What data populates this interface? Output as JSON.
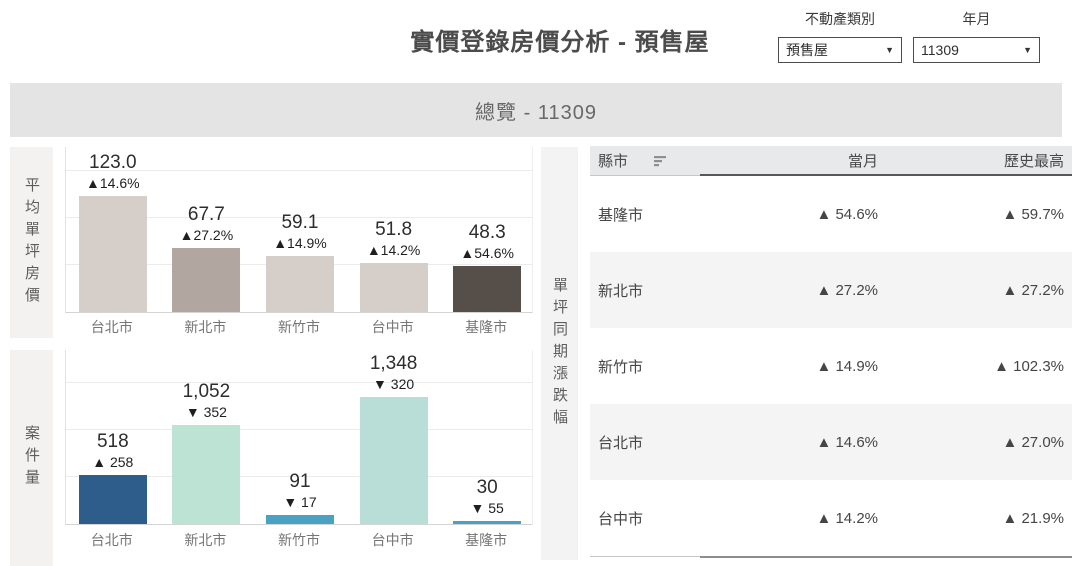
{
  "header": {
    "title": "實價登錄房價分析 - 預售屋",
    "filters": {
      "property_type": {
        "label": "不動產類別",
        "value": "預售屋"
      },
      "year_month": {
        "label": "年月",
        "value": "11309"
      }
    },
    "dropdown_arrow": "▼"
  },
  "banner": {
    "title": "總覽 - 11309"
  },
  "middle_axis_label": "單坪同期漲跌幅",
  "chart_data": [
    {
      "type": "bar",
      "title": "平均單坪房價",
      "categories": [
        "台北市",
        "新北市",
        "新竹市",
        "台中市",
        "基隆市"
      ],
      "values": [
        123.0,
        67.7,
        59.1,
        51.8,
        48.3
      ],
      "value_labels": [
        "123.0",
        "67.7",
        "59.1",
        "51.8",
        "48.3"
      ],
      "change_labels": [
        "▲14.6%",
        "▲27.2%",
        "▲14.9%",
        "▲14.2%",
        "▲54.6%"
      ],
      "bar_colors": [
        "#d5cec9",
        "#b1a7a0",
        "#d5cec9",
        "#d5cec9",
        "#564e49"
      ],
      "xlabel": "",
      "ylabel": "平均單坪房價",
      "ylim": [
        0,
        175
      ],
      "grid": true,
      "legend": false
    },
    {
      "type": "bar",
      "title": "案件量",
      "categories": [
        "台北市",
        "新北市",
        "新竹市",
        "台中市",
        "基隆市"
      ],
      "values": [
        518,
        1052,
        91,
        1348,
        30
      ],
      "value_labels": [
        "518",
        "1,052",
        "91",
        "1,348",
        "30"
      ],
      "change_labels": [
        "▲ 258",
        "▼ 352",
        "▼ 17",
        "▼ 320",
        "▼ 55"
      ],
      "bar_colors": [
        "#2e5d8b",
        "#bce3d3",
        "#4ba1c2",
        "#b9ddd7",
        "#4ba1c2"
      ],
      "xlabel": "",
      "ylabel": "案件量",
      "ylim": [
        0,
        1850
      ],
      "grid": true,
      "legend": false
    },
    {
      "type": "table",
      "title": "單坪同期漲跌幅",
      "columns": [
        "縣市",
        "當月",
        "歷史最高"
      ],
      "rows": [
        [
          "基隆市",
          "▲ 54.6%",
          "▲ 59.7%"
        ],
        [
          "新北市",
          "▲ 27.2%",
          "▲ 27.2%"
        ],
        [
          "新竹市",
          "▲ 14.9%",
          "▲ 102.3%"
        ],
        [
          "台北市",
          "▲ 14.6%",
          "▲ 27.0%"
        ],
        [
          "台中市",
          "▲ 14.2%",
          "▲ 21.9%"
        ]
      ]
    }
  ],
  "table": {
    "header": {
      "city": "縣市",
      "current_month": "當月",
      "historical_high": "歷史最高"
    },
    "rows": [
      {
        "city": "基隆市",
        "current": "▲ 54.6%",
        "high": "▲ 59.7%"
      },
      {
        "city": "新北市",
        "current": "▲ 27.2%",
        "high": "▲ 27.2%"
      },
      {
        "city": "新竹市",
        "current": "▲ 14.9%",
        "high": "▲ 102.3%"
      },
      {
        "city": "台北市",
        "current": "▲ 14.6%",
        "high": "▲ 27.0%"
      },
      {
        "city": "台中市",
        "current": "▲ 14.2%",
        "high": "▲ 21.9%"
      }
    ]
  }
}
